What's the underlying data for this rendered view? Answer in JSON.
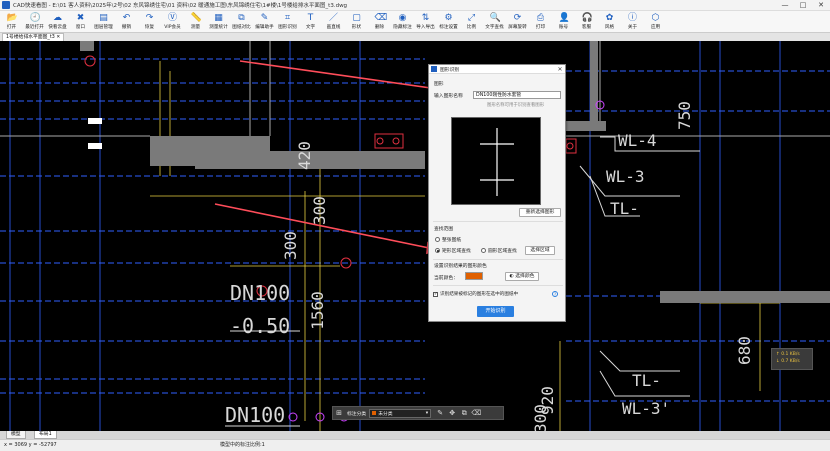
{
  "window": {
    "title": "CAD快速看图 - E:\\01 客人资料\\2025年\\2号\\02 东风锦绣住宅\\01 资料\\02 暖通施工图\\东风锦绣住宅\\1#楼\\1号楼给排水平面图_t3.dwg",
    "minimize": "—",
    "maximize": "□",
    "close": "✕"
  },
  "toolbar": {
    "items": [
      {
        "label": "打开",
        "icon": "📂"
      },
      {
        "label": "最近打开",
        "icon": "🕘"
      },
      {
        "label": "快看云盘",
        "icon": "☁"
      },
      {
        "label": "窗口",
        "icon": "✖"
      },
      {
        "label": "图层管理",
        "icon": "▤"
      },
      {
        "label": "撤销",
        "icon": "↶"
      },
      {
        "label": "恢复",
        "icon": "↷"
      },
      {
        "label": "VIP会员",
        "icon": "Ⓥ"
      },
      {
        "label": "测量",
        "icon": "📏"
      },
      {
        "label": "测量统计",
        "icon": "▦"
      },
      {
        "label": "图纸对比",
        "icon": "⧉"
      },
      {
        "label": "编辑助手",
        "icon": "✎"
      },
      {
        "label": "图形识别",
        "icon": "⌗"
      },
      {
        "label": "文字",
        "icon": "T"
      },
      {
        "label": "画直线",
        "icon": "／"
      },
      {
        "label": "形状",
        "icon": "▢"
      },
      {
        "label": "删除",
        "icon": "⌫"
      },
      {
        "label": "隐藏标注",
        "icon": "◉"
      },
      {
        "label": "导入导出",
        "icon": "⇅"
      },
      {
        "label": "标注设置",
        "icon": "⚙"
      },
      {
        "label": "比例",
        "icon": "⤢"
      },
      {
        "label": "文字查找",
        "icon": "🔍"
      },
      {
        "label": "屏幕旋转",
        "icon": "⟳"
      },
      {
        "label": "打印",
        "icon": "⎙"
      },
      {
        "label": "账号",
        "icon": "👤"
      },
      {
        "label": "客服",
        "icon": "🎧"
      },
      {
        "label": "风格",
        "icon": "✿"
      },
      {
        "label": "关于",
        "icon": "ⓘ"
      },
      {
        "label": "应用",
        "icon": "⬡"
      }
    ]
  },
  "doc_tab": {
    "label": "1号楼给排水平面图_t3 ✕"
  },
  "cad": {
    "labels": {
      "wl4": "WL-4",
      "wl3": "WL-3",
      "tl": "TL-",
      "dn100a": "DN100",
      "neg050": "-0.50",
      "dn100b": "DN100",
      "tl2": "TL-",
      "wl3b": "WL-3'",
      "n750": "750",
      "n420": "420",
      "n300a": "300",
      "n300b": "300",
      "n1560": "1560",
      "n680": "680",
      "n920": "920",
      "n300c": "300"
    }
  },
  "dialog": {
    "title": "图形识别",
    "close": "✕",
    "shape_section": "图形",
    "name_label": "输入图形名称",
    "name_value": "DN100刚性防水套管",
    "name_hint": "图形名称可用于识别查看图形",
    "reselect_button": "重新选择图形",
    "range_section": "查找范围",
    "radio_whole": "整张图纸",
    "radio_rect": "矩形区域查找",
    "radio_circle": "圆形区域查找",
    "select_area_button": "选择区域",
    "color_section": "设置识别结果的图形颜色",
    "current_color_label": "当前颜色：",
    "current_color": "#e06000",
    "choose_color_button": "选择颜色",
    "checkbox_label": "识别结果被标记的图形在选中的图纸中",
    "help": "?",
    "start_button": "开始识别"
  },
  "floatbar": {
    "category_label": "标注分类",
    "selected": "未分类"
  },
  "net_widget": {
    "up": "↑ 0.1 KB/s",
    "down": "↓ 0.7 KB/s"
  },
  "bottom_tabs": {
    "model": "模型",
    "layout": "布局1"
  },
  "status": {
    "coords": "x = 3069  y = -52797",
    "scale": "模型中的标注比例:1"
  },
  "colors": {
    "accent": "#2a7fe0",
    "arrow": "#ff4d5a",
    "cad_blue": "#3060ff",
    "cad_yellow": "#e8d040"
  }
}
